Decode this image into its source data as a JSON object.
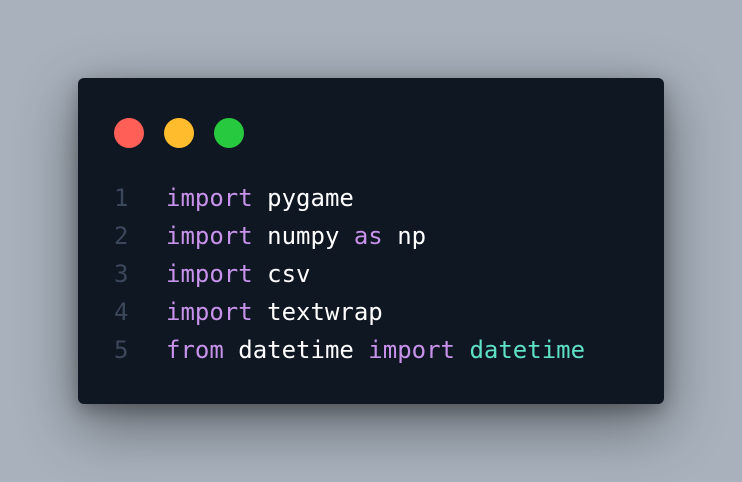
{
  "colors": {
    "background": "#a8b1bc",
    "window": "#0f1723",
    "line_number": "#3b475a",
    "keyword": "#c792ea",
    "plain": "#ffffff",
    "class_name": "#5ee0c7"
  },
  "window_controls": [
    {
      "name": "close-dot",
      "color": "#ff5f56"
    },
    {
      "name": "minimize-dot",
      "color": "#ffbd2e"
    },
    {
      "name": "maximize-dot",
      "color": "#27c93f"
    }
  ],
  "code_lines": [
    {
      "number": "1",
      "tokens": [
        {
          "text": "import",
          "kind": "keyword"
        },
        {
          "text": " pygame",
          "kind": "plain"
        }
      ]
    },
    {
      "number": "2",
      "tokens": [
        {
          "text": "import",
          "kind": "keyword"
        },
        {
          "text": " numpy ",
          "kind": "plain"
        },
        {
          "text": "as",
          "kind": "keyword"
        },
        {
          "text": " np",
          "kind": "plain"
        }
      ]
    },
    {
      "number": "3",
      "tokens": [
        {
          "text": "import",
          "kind": "keyword"
        },
        {
          "text": " csv",
          "kind": "plain"
        }
      ]
    },
    {
      "number": "4",
      "tokens": [
        {
          "text": "import",
          "kind": "keyword"
        },
        {
          "text": " textwrap",
          "kind": "plain"
        }
      ]
    },
    {
      "number": "5",
      "tokens": [
        {
          "text": "from",
          "kind": "keyword"
        },
        {
          "text": " datetime ",
          "kind": "plain"
        },
        {
          "text": "import",
          "kind": "keyword"
        },
        {
          "text": " ",
          "kind": "plain"
        },
        {
          "text": "datetime",
          "kind": "class_name"
        }
      ]
    }
  ]
}
